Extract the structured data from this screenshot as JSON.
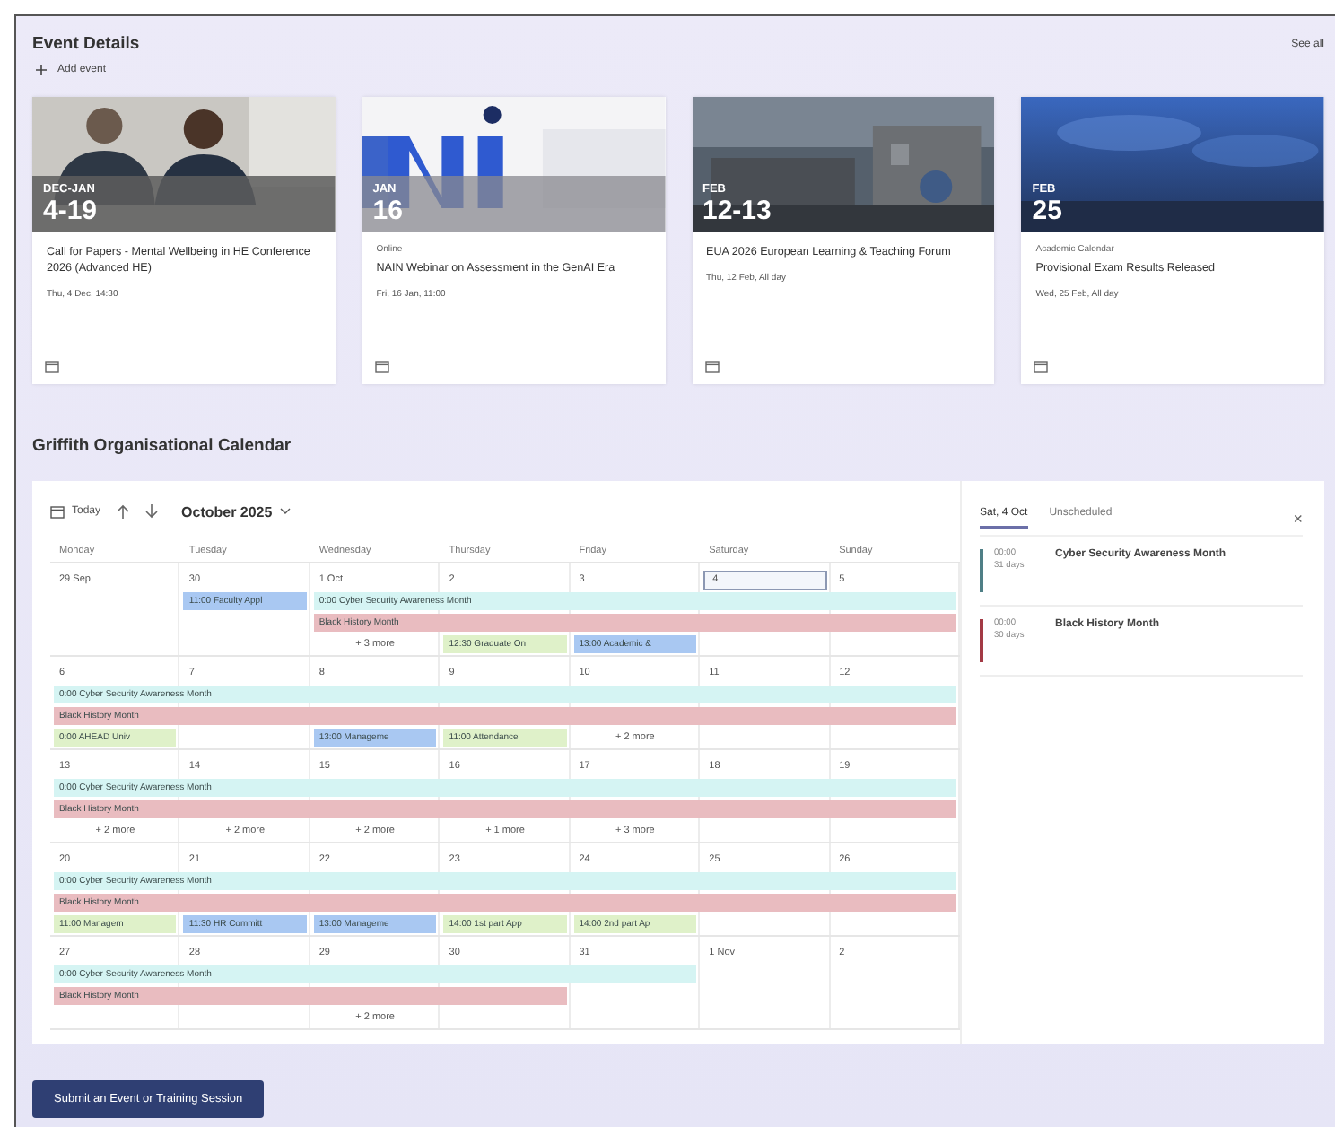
{
  "events_section": {
    "title": "Event Details",
    "add_label": "Add event",
    "see_all": "See all",
    "cards": [
      {
        "month": "DEC-JAN",
        "day": "4-19",
        "title": "Call for Papers - Mental Wellbeing in HE Conference 2026 (Advanced HE)",
        "when": "Thu, 4 Dec, 14:30"
      },
      {
        "month": "JAN",
        "day": "16",
        "category": "Online",
        "title": "NAIN Webinar on Assessment in the GenAI Era",
        "when": "Fri, 16 Jan, 11:00"
      },
      {
        "month": "FEB",
        "day": "12-13",
        "title": "EUA 2026 European Learning & Teaching Forum",
        "when": "Thu, 12 Feb, All day"
      },
      {
        "month": "FEB",
        "day": "25",
        "category": "Academic Calendar",
        "title": "Provisional Exam Results Released",
        "when": "Wed, 25 Feb, All day"
      }
    ]
  },
  "calendar": {
    "title": "Griffith Organisational Calendar",
    "today": "Today",
    "month": "October 2025",
    "weekdays": [
      "Monday",
      "Tuesday",
      "Wednesday",
      "Thursday",
      "Friday",
      "Saturday",
      "Sunday"
    ],
    "weeks": [
      {
        "days": [
          {
            "label": "29 Sep",
            "selected": false
          },
          {
            "label": "30",
            "selected": false
          },
          {
            "label": "1 Oct",
            "selected": false
          },
          {
            "label": "2",
            "selected": false
          },
          {
            "label": "3",
            "selected": false
          },
          {
            "label": "4",
            "selected": true
          },
          {
            "label": "5",
            "selected": false
          }
        ],
        "lanes": [
          [
            {
              "kind": "empty"
            },
            {
              "kind": "event",
              "text": "11:00 Faculty Appl",
              "color": "#a9c8f2"
            },
            {
              "kind": "event",
              "text": "0:00 Cyber Security Awareness Month",
              "color": "#d5f4f3"
            },
            {
              "kind": "cont"
            },
            {
              "kind": "cont"
            },
            {
              "kind": "cont"
            },
            {
              "kind": "cont"
            }
          ],
          [
            {
              "kind": "empty"
            },
            {
              "kind": "empty"
            },
            {
              "kind": "event",
              "text": "Black History Month",
              "color": "#e9bcc0"
            },
            {
              "kind": "cont"
            },
            {
              "kind": "cont"
            },
            {
              "kind": "cont"
            },
            {
              "kind": "cont"
            }
          ],
          [
            {
              "kind": "empty"
            },
            {
              "kind": "empty"
            },
            {
              "kind": "more",
              "text": "+ 3 more"
            },
            {
              "kind": "event",
              "text": "12:30 Graduate On",
              "color": "#dff1c9"
            },
            {
              "kind": "event",
              "text": "13:00 Academic &",
              "color": "#a9c8f2"
            },
            {
              "kind": "empty"
            },
            {
              "kind": "empty"
            }
          ]
        ]
      },
      {
        "days": [
          {
            "label": "6",
            "selected": false
          },
          {
            "label": "7",
            "selected": false
          },
          {
            "label": "8",
            "selected": false
          },
          {
            "label": "9",
            "selected": false
          },
          {
            "label": "10",
            "selected": false
          },
          {
            "label": "11",
            "selected": false
          },
          {
            "label": "12",
            "selected": false
          }
        ],
        "lanes": [
          [
            {
              "kind": "event",
              "text": "0:00 Cyber Security Awareness Month",
              "color": "#d5f4f3"
            },
            {
              "kind": "cont"
            },
            {
              "kind": "cont"
            },
            {
              "kind": "cont"
            },
            {
              "kind": "cont"
            },
            {
              "kind": "cont"
            },
            {
              "kind": "cont"
            }
          ],
          [
            {
              "kind": "event",
              "text": "Black History Month",
              "color": "#e9bcc0"
            },
            {
              "kind": "cont"
            },
            {
              "kind": "cont"
            },
            {
              "kind": "cont"
            },
            {
              "kind": "cont"
            },
            {
              "kind": "cont"
            },
            {
              "kind": "cont"
            }
          ],
          [
            {
              "kind": "event",
              "text": "0:00 AHEAD Univ",
              "color": "#dff1c9"
            },
            {
              "kind": "empty"
            },
            {
              "kind": "event",
              "text": "13:00 Manageme",
              "color": "#a9c8f2"
            },
            {
              "kind": "event",
              "text": "11:00 Attendance",
              "color": "#dff1c9"
            },
            {
              "kind": "more",
              "text": "+ 2 more"
            },
            {
              "kind": "empty"
            },
            {
              "kind": "empty"
            }
          ]
        ]
      },
      {
        "days": [
          {
            "label": "13",
            "selected": false
          },
          {
            "label": "14",
            "selected": false
          },
          {
            "label": "15",
            "selected": false
          },
          {
            "label": "16",
            "selected": false
          },
          {
            "label": "17",
            "selected": false
          },
          {
            "label": "18",
            "selected": false
          },
          {
            "label": "19",
            "selected": false
          }
        ],
        "lanes": [
          [
            {
              "kind": "event",
              "text": "0:00 Cyber Security Awareness Month",
              "color": "#d5f4f3"
            },
            {
              "kind": "cont"
            },
            {
              "kind": "cont"
            },
            {
              "kind": "cont"
            },
            {
              "kind": "cont"
            },
            {
              "kind": "cont"
            },
            {
              "kind": "cont"
            }
          ],
          [
            {
              "kind": "event",
              "text": "Black History Month",
              "color": "#e9bcc0"
            },
            {
              "kind": "cont"
            },
            {
              "kind": "cont"
            },
            {
              "kind": "cont"
            },
            {
              "kind": "cont"
            },
            {
              "kind": "cont"
            },
            {
              "kind": "cont"
            }
          ],
          [
            {
              "kind": "more",
              "text": "+ 2 more"
            },
            {
              "kind": "more",
              "text": "+ 2 more"
            },
            {
              "kind": "more",
              "text": "+ 2 more"
            },
            {
              "kind": "more",
              "text": "+ 1 more"
            },
            {
              "kind": "more",
              "text": "+ 3 more"
            },
            {
              "kind": "empty"
            },
            {
              "kind": "empty"
            }
          ]
        ]
      },
      {
        "days": [
          {
            "label": "20",
            "selected": false
          },
          {
            "label": "21",
            "selected": false
          },
          {
            "label": "22",
            "selected": false
          },
          {
            "label": "23",
            "selected": false
          },
          {
            "label": "24",
            "selected": false
          },
          {
            "label": "25",
            "selected": false
          },
          {
            "label": "26",
            "selected": false
          }
        ],
        "lanes": [
          [
            {
              "kind": "event",
              "text": "0:00 Cyber Security Awareness Month",
              "color": "#d5f4f3"
            },
            {
              "kind": "cont"
            },
            {
              "kind": "cont"
            },
            {
              "kind": "cont"
            },
            {
              "kind": "cont"
            },
            {
              "kind": "cont"
            },
            {
              "kind": "cont"
            }
          ],
          [
            {
              "kind": "event",
              "text": "Black History Month",
              "color": "#e9bcc0"
            },
            {
              "kind": "cont"
            },
            {
              "kind": "cont"
            },
            {
              "kind": "cont"
            },
            {
              "kind": "cont"
            },
            {
              "kind": "cont"
            },
            {
              "kind": "cont"
            }
          ],
          [
            {
              "kind": "event",
              "text": "11:00 Managem",
              "color": "#dff1c9"
            },
            {
              "kind": "event",
              "text": "11:30 HR Committ",
              "color": "#a9c8f2"
            },
            {
              "kind": "event",
              "text": "13:00 Manageme",
              "color": "#a9c8f2"
            },
            {
              "kind": "event",
              "text": "14:00 1st part App",
              "color": "#dff1c9"
            },
            {
              "kind": "event",
              "text": "14:00 2nd part Ap",
              "color": "#dff1c9"
            },
            {
              "kind": "empty"
            },
            {
              "kind": "empty"
            }
          ]
        ]
      },
      {
        "days": [
          {
            "label": "27",
            "selected": false
          },
          {
            "label": "28",
            "selected": false
          },
          {
            "label": "29",
            "selected": false
          },
          {
            "label": "30",
            "selected": false
          },
          {
            "label": "31",
            "selected": false
          },
          {
            "label": "1 Nov",
            "selected": false
          },
          {
            "label": "2",
            "selected": false
          }
        ],
        "lanes": [
          [
            {
              "kind": "event",
              "text": "0:00 Cyber Security Awareness Month",
              "color": "#d5f4f3"
            },
            {
              "kind": "cont"
            },
            {
              "kind": "cont"
            },
            {
              "kind": "cont"
            },
            {
              "kind": "cont"
            },
            {
              "kind": "empty"
            },
            {
              "kind": "empty"
            }
          ],
          [
            {
              "kind": "event",
              "text": "Black History Month",
              "color": "#e9bcc0"
            },
            {
              "kind": "cont"
            },
            {
              "kind": "cont"
            },
            {
              "kind": "cont"
            },
            {
              "kind": "empty"
            },
            {
              "kind": "empty"
            },
            {
              "kind": "empty"
            }
          ],
          [
            {
              "kind": "empty"
            },
            {
              "kind": "empty"
            },
            {
              "kind": "more",
              "text": "+ 2 more"
            },
            {
              "kind": "empty"
            },
            {
              "kind": "empty"
            },
            {
              "kind": "empty"
            },
            {
              "kind": "empty"
            }
          ]
        ]
      }
    ]
  },
  "side_panel": {
    "tabs": [
      {
        "label": "Sat, 4 Oct",
        "selected": true
      },
      {
        "label": "Unscheduled",
        "selected": false
      }
    ],
    "close": "×",
    "items": [
      {
        "time": "00:00",
        "duration": "31 days",
        "title": "Cyber Security Awareness Month",
        "color": "#4f7f86"
      },
      {
        "time": "00:00",
        "duration": "30 days",
        "title": "Black History Month",
        "color": "#a33a45"
      }
    ]
  },
  "submit_button": "Submit an Event or Training Session"
}
